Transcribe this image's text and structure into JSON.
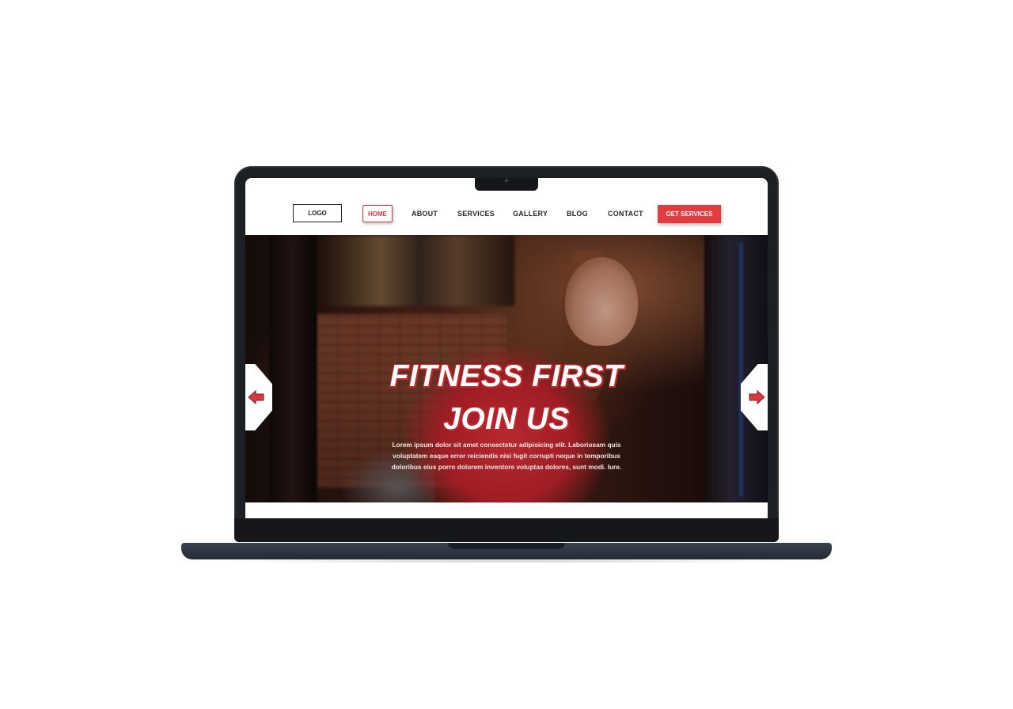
{
  "nav": {
    "logo": "LOGO",
    "items": [
      {
        "label": "HOME",
        "active": true
      },
      {
        "label": "ABOUT"
      },
      {
        "label": "SERVICES"
      },
      {
        "label": "GALLERY"
      },
      {
        "label": "BLOG"
      },
      {
        "label": "CONTACT"
      }
    ],
    "cta": "GET SERVICES"
  },
  "hero": {
    "title_line1": "FITNESS FIRST",
    "title_line2": "JOIN US",
    "text_line1": "Lorem ipsum dolor sit amet consectetur adipisicing elit. Laboriosam quis",
    "text_line2": "voluptatem eaque error reiciendis nisi fugit corrupti neque in temporibus",
    "text_line3": "doloribus eius porro dolorem inventore voluptas dolores, sunt modi. Iure.",
    "prev_icon": "arrow-left-icon",
    "next_icon": "arrow-right-icon"
  },
  "colors": {
    "accent": "#e23b40",
    "text_dark": "#2a2a2a",
    "laptop_frame": "#1c1f24"
  }
}
